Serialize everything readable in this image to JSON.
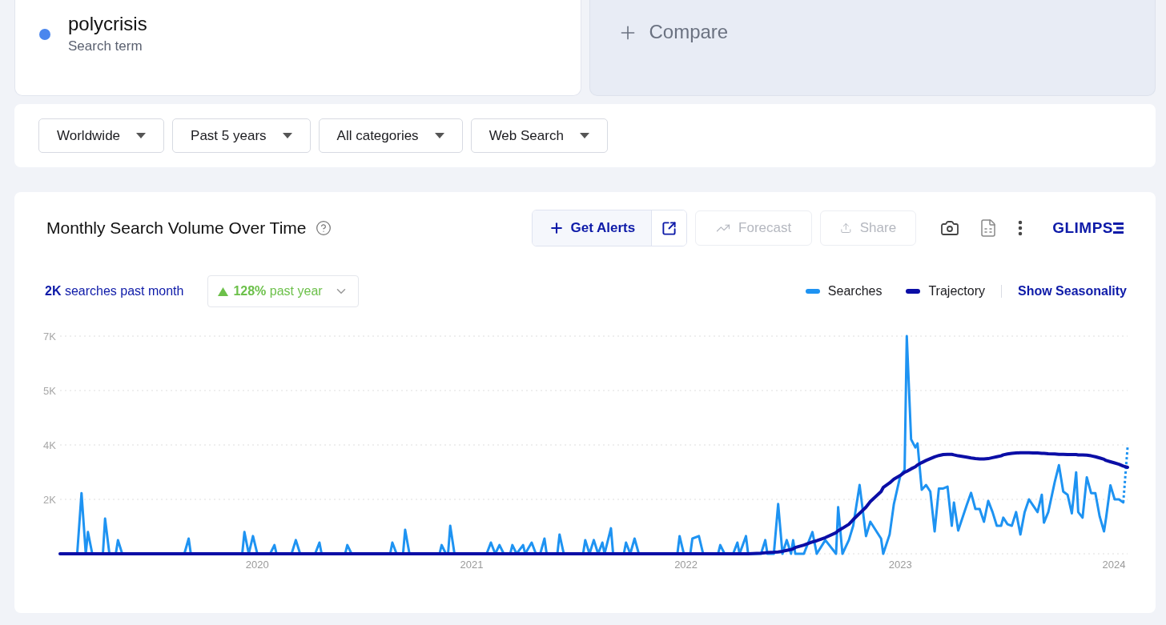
{
  "search_terms": [
    {
      "term": "polycrisis",
      "subtitle": "Search term",
      "color": "#4a86ee"
    }
  ],
  "compare": {
    "label": "Compare"
  },
  "filters": [
    {
      "label": "Worldwide"
    },
    {
      "label": "Past 5 years"
    },
    {
      "label": "All categories"
    },
    {
      "label": "Web Search"
    }
  ],
  "chart_card": {
    "title": "Monthly Search Volume Over Time",
    "toolbar": [
      {
        "kind": "alerts",
        "label": "Get Alerts",
        "disabled": false
      },
      {
        "kind": "forecast",
        "label": "Forecast",
        "disabled": true
      },
      {
        "kind": "share",
        "label": "Share",
        "disabled": true
      }
    ],
    "brand": "GLIMPS",
    "searches_stat": "**2K** searches past month",
    "growth": {
      "text": "**128%** past year"
    },
    "seasonality_link": "Show Seasonality",
    "chart_data": {
      "type": "line",
      "grid": true,
      "xlim": [
        2019.08,
        2024.06
      ],
      "ylim": [
        0,
        7000
      ],
      "yticks": [
        {
          "value": 1750,
          "label": "2K"
        },
        {
          "value": 3500,
          "label": "4K"
        },
        {
          "value": 5250,
          "label": "5K"
        },
        {
          "value": 7000,
          "label": "7K"
        }
      ],
      "xticks": [
        2020,
        2021,
        2022,
        2023,
        2024
      ],
      "x": [
        2019.08,
        2019.16,
        2019.18,
        2019.2,
        2019.21,
        2019.23,
        2019.28,
        2019.29,
        2019.31,
        2019.34,
        2019.35,
        2019.37,
        2019.66,
        2019.68,
        2019.69,
        2019.93,
        2019.94,
        2019.96,
        2019.98,
        2020.0,
        2020.06,
        2020.08,
        2020.09,
        2020.16,
        2020.18,
        2020.2,
        2020.27,
        2020.29,
        2020.3,
        2020.41,
        2020.42,
        2020.44,
        2020.62,
        2020.63,
        2020.65,
        2020.68,
        2020.69,
        2020.71,
        2020.85,
        2020.86,
        2020.88,
        2020.89,
        2020.9,
        2020.92,
        2021.07,
        2021.09,
        2021.11,
        2021.13,
        2021.15,
        2021.18,
        2021.19,
        2021.21,
        2021.24,
        2021.25,
        2021.28,
        2021.3,
        2021.32,
        2021.34,
        2021.35,
        2021.4,
        2021.41,
        2021.43,
        2021.52,
        2021.53,
        2021.55,
        2021.57,
        2021.59,
        2021.61,
        2021.62,
        2021.65,
        2021.66,
        2021.71,
        2021.72,
        2021.74,
        2021.76,
        2021.78,
        2021.96,
        2021.97,
        2021.99,
        2022.02,
        2022.03,
        2022.06,
        2022.08,
        2022.15,
        2022.16,
        2022.18,
        2022.22,
        2022.24,
        2022.25,
        2022.28,
        2022.29,
        2022.35,
        2022.37,
        2022.38,
        2022.41,
        2022.43,
        2022.45,
        2022.47,
        2022.49,
        2022.5,
        2022.51,
        2022.55,
        2022.59,
        2022.61,
        2022.65,
        2022.7,
        2022.71,
        2022.73,
        2022.76,
        2022.78,
        2022.81,
        2022.84,
        2022.86,
        2022.91,
        2022.92,
        2022.95,
        2022.97,
        2023.0,
        2023.02,
        2023.03,
        2023.05,
        2023.07,
        2023.08,
        2023.1,
        2023.12,
        2023.14,
        2023.16,
        2023.18,
        2023.2,
        2023.22,
        2023.24,
        2023.25,
        2023.27,
        2023.31,
        2023.33,
        2023.35,
        2023.37,
        2023.39,
        2023.41,
        2023.43,
        2023.45,
        2023.47,
        2023.48,
        2023.5,
        2023.52,
        2023.54,
        2023.56,
        2023.58,
        2023.6,
        2023.62,
        2023.64,
        2023.66,
        2023.67,
        2023.69,
        2023.72,
        2023.74,
        2023.76,
        2023.78,
        2023.8,
        2023.82,
        2023.83,
        2023.85,
        2023.87,
        2023.89,
        2023.91,
        2023.93,
        2023.95,
        2023.96,
        2023.98,
        2024.0,
        2024.02,
        2024.04,
        2024.06
      ],
      "series": [
        {
          "name": "Searches",
          "color": "#1e93f2",
          "values": [
            0,
            0,
            1950,
            0,
            700,
            0,
            0,
            1130,
            0,
            0,
            440,
            0,
            0,
            490,
            0,
            0,
            700,
            0,
            570,
            0,
            0,
            280,
            0,
            0,
            440,
            0,
            0,
            360,
            0,
            0,
            280,
            0,
            0,
            360,
            0,
            0,
            770,
            0,
            0,
            280,
            0,
            0,
            900,
            0,
            0,
            360,
            0,
            280,
            0,
            0,
            280,
            0,
            280,
            0,
            360,
            0,
            0,
            490,
            0,
            0,
            620,
            0,
            0,
            440,
            0,
            440,
            0,
            360,
            0,
            820,
            0,
            0,
            360,
            0,
            490,
            0,
            0,
            570,
            0,
            0,
            490,
            570,
            0,
            0,
            280,
            0,
            0,
            360,
            0,
            570,
            0,
            0,
            440,
            0,
            0,
            1600,
            0,
            440,
            0,
            440,
            0,
            0,
            700,
            0,
            440,
            0,
            1500,
            0,
            440,
            900,
            2210,
            570,
            1030,
            490,
            0,
            620,
            1600,
            2520,
            2700,
            7000,
            3680,
            3420,
            3550,
            2060,
            2210,
            2000,
            720,
            2100,
            2100,
            2160,
            900,
            1650,
            750,
            1570,
            1960,
            1440,
            1440,
            1030,
            1700,
            1340,
            900,
            900,
            1160,
            950,
            900,
            1340,
            620,
            1340,
            1750,
            1550,
            1340,
            1900,
            1000,
            1340,
            2300,
            2850,
            2000,
            1900,
            1300,
            2620,
            1340,
            1160,
            2460,
            1950,
            1950,
            1200,
            720,
            1160,
            2200,
            1750,
            1750,
            1650,
            3420
          ]
        },
        {
          "name": "Trajectory",
          "color": "#0b0ea6",
          "values": [
            0,
            0,
            0,
            0,
            0,
            0,
            0,
            0,
            0,
            0,
            0,
            0,
            0,
            0,
            0,
            0,
            0,
            0,
            0,
            0,
            0,
            0,
            0,
            0,
            0,
            0,
            0,
            0,
            0,
            0,
            0,
            0,
            0,
            0,
            0,
            0,
            0,
            0,
            0,
            0,
            0,
            0,
            0,
            0,
            0,
            0,
            0,
            0,
            0,
            0,
            0,
            0,
            0,
            0,
            0,
            0,
            0,
            0,
            0,
            0,
            0,
            0,
            0,
            0,
            0,
            0,
            0,
            0,
            0,
            0,
            0,
            0,
            0,
            0,
            0,
            0,
            0,
            0,
            0,
            0,
            0,
            0,
            0,
            0,
            0,
            0,
            0,
            0,
            0,
            0,
            0,
            20,
            30,
            40,
            50,
            60,
            80,
            110,
            140,
            160,
            200,
            280,
            380,
            420,
            520,
            680,
            740,
            820,
            950,
            1100,
            1300,
            1500,
            1680,
            2000,
            2130,
            2280,
            2400,
            2520,
            2620,
            2650,
            2730,
            2800,
            2860,
            2930,
            3000,
            3060,
            3120,
            3160,
            3190,
            3200,
            3200,
            3180,
            3150,
            3110,
            3080,
            3060,
            3050,
            3050,
            3060,
            3090,
            3120,
            3150,
            3180,
            3210,
            3230,
            3240,
            3250,
            3250,
            3250,
            3240,
            3240,
            3230,
            3230,
            3220,
            3210,
            3200,
            3200,
            3190,
            3190,
            3190,
            3180,
            3180,
            3170,
            3150,
            3120,
            3080,
            3040,
            3000,
            2960,
            2920,
            2880,
            2820,
            2780
          ]
        }
      ]
    }
  }
}
